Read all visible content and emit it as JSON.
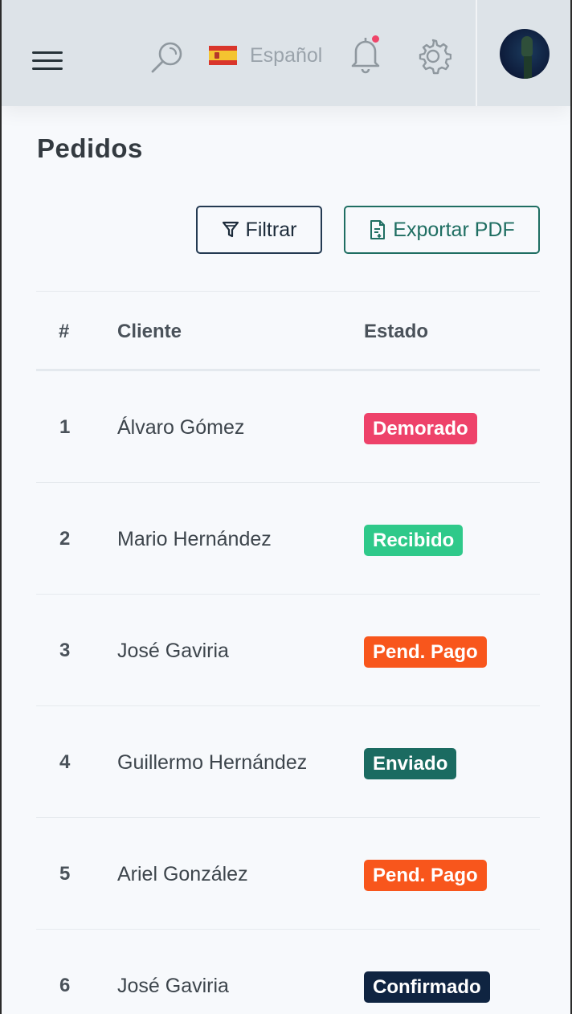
{
  "header": {
    "language_label": "Español",
    "has_notifications": true
  },
  "page": {
    "title": "Pedidos"
  },
  "toolbar": {
    "filter_label": "Filtrar",
    "export_label": "Exportar PDF"
  },
  "table": {
    "columns": [
      "#",
      "Cliente",
      "Estado"
    ],
    "rows": [
      {
        "num": "1",
        "client": "Álvaro Gómez",
        "status": "Demorado"
      },
      {
        "num": "2",
        "client": "Mario Hernández",
        "status": "Recibido"
      },
      {
        "num": "3",
        "client": "José Gaviria",
        "status": "Pend. Pago"
      },
      {
        "num": "4",
        "client": "Guillermo Hernández",
        "status": "Enviado"
      },
      {
        "num": "5",
        "client": "Ariel González",
        "status": "Pend. Pago"
      },
      {
        "num": "6",
        "client": "José Gaviria",
        "status": "Confirmado"
      }
    ]
  },
  "status_colors": {
    "Demorado": "#ee426a",
    "Recibido": "#2fc98a",
    "Pend. Pago": "#f8561c",
    "Enviado": "#1b6b61",
    "Confirmado": "#0f2441"
  },
  "icons": [
    "menu-icon",
    "search-icon",
    "spain-flag-icon",
    "bell-icon",
    "gear-icon",
    "filter-icon",
    "file-export-icon"
  ]
}
